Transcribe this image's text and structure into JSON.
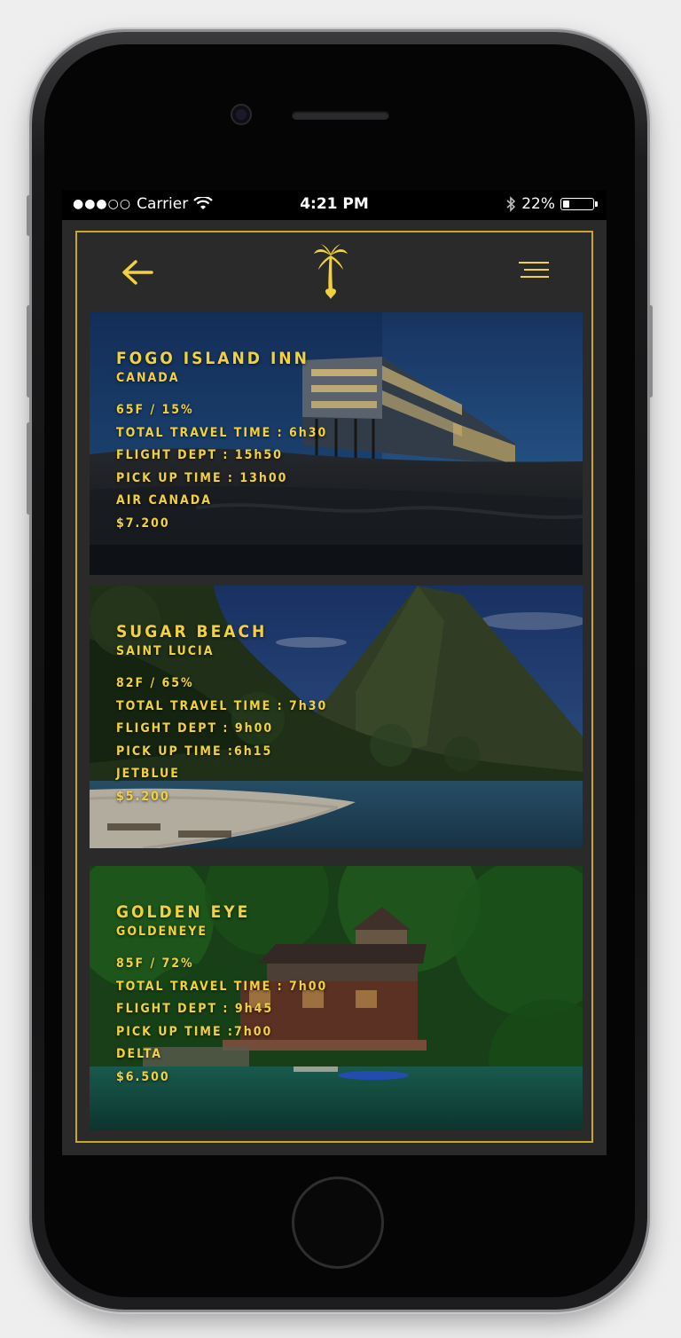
{
  "status_bar": {
    "signal": "●●●○○",
    "carrier": "Carrier",
    "time": "4:21 PM",
    "battery_percent": "22%",
    "battery_level": 0.22
  },
  "header": {
    "back_icon": "arrow-left-icon",
    "logo_icon": "palm-tree-icon",
    "menu_icon": "hamburger-menu-icon"
  },
  "colors": {
    "accent": "#f2d23c",
    "frame": "#c8a82c",
    "background": "#2a2a2a"
  },
  "destinations": [
    {
      "title": "FOGO ISLAND INN",
      "location": "CANADA",
      "weather": "65F / 15%",
      "travel_time": "TOTAL TRAVEL TIME : 6h30",
      "flight_dept": "FLIGHT DEPT : 15h50",
      "pickup_time": "PICK UP TIME : 13h00",
      "airline": "AIR CANADA",
      "price": "$7.200"
    },
    {
      "title": "SUGAR BEACH",
      "location": "SAINT LUCIA",
      "weather": "82F / 65%",
      "travel_time": "TOTAL TRAVEL TIME : 7h30",
      "flight_dept": "FLIGHT DEPT : 9h00",
      "pickup_time": "PICK UP TIME :6h15",
      "airline": "JETBLUE",
      "price": "$5.200"
    },
    {
      "title": "GOLDEN EYE",
      "location": "GOLDENEYE",
      "weather": "85F / 72%",
      "travel_time": "TOTAL TRAVEL TIME : 7h00",
      "flight_dept": "FLIGHT DEPT : 9h45",
      "pickup_time": "PICK UP TIME :7h00",
      "airline": "DELTA",
      "price": "$6.500"
    }
  ]
}
